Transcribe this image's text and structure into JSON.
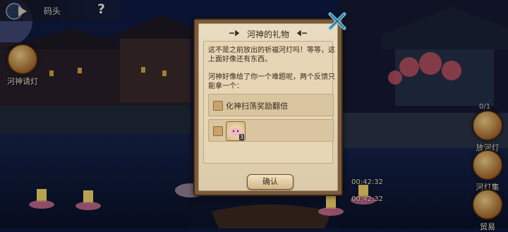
{
  "header": {
    "location": "码头",
    "help_symbol": "?"
  },
  "left_menu": {
    "river_spirit_label": "河神请灯"
  },
  "right_menu": {
    "counter": "0/1",
    "release_lantern": "放河灯",
    "lantern_collection": "河灯集",
    "trade": "贸易"
  },
  "timers": [
    "00:42:32",
    "00:42:32"
  ],
  "dialog": {
    "title": "河神的礼物",
    "paragraph1": "这不是之前放出的祈福河灯吗！等等，这上面好像还有东西。",
    "paragraph2": "河神好像给了你一个难题呢，两个反馈只能拿一个：",
    "option1_text": "化神扫荡奖励翻倍",
    "option2_item_count": "3",
    "confirm_label": "确认"
  },
  "colors": {
    "dialog_frame": "#7a5a3c",
    "dialog_paper": "#e9dcc2",
    "close_accent": "#6ec3e0"
  }
}
